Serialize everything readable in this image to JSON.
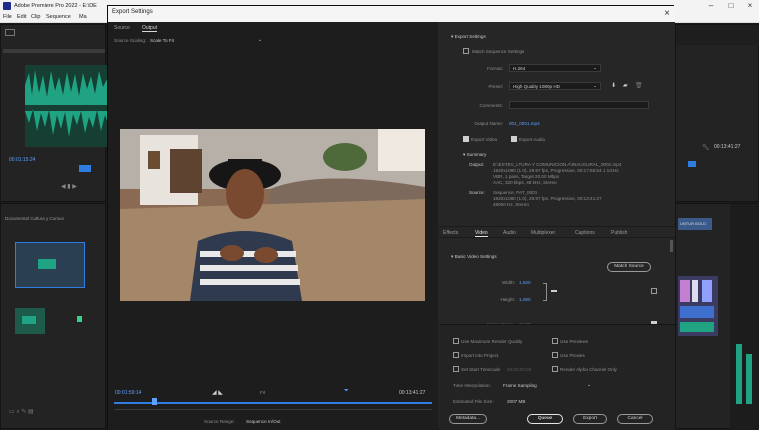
{
  "app": {
    "title": "Adobe Premiere Pro 2022 - E:\\DE",
    "menu": [
      "File",
      "Edit",
      "Clip",
      "Sequence",
      "Ma"
    ]
  },
  "background": {
    "source_time": "00:01:15:24",
    "timeline_time": "00:13:41:27",
    "project_label": "Documental Cultura y Comun",
    "timeline_clip_label": "UNTUR BOLD"
  },
  "dialog": {
    "title": "Export Settings",
    "close": "×",
    "tabs": {
      "source": "Source",
      "output": "Output"
    },
    "source_scaling": {
      "label": "Source Scaling:",
      "value": "Scale To Fit"
    },
    "timecode_in": "00:01:59:14",
    "timecode_out": "00:13:41:27",
    "fit_label": "Fit",
    "source_range": {
      "label": "Source Range:",
      "value": "Sequence In/Out"
    }
  },
  "export_settings": {
    "header": "Export Settings",
    "match_sequence": "Match Sequence Settings",
    "format": {
      "label": "Format:",
      "value": "H.264"
    },
    "preset": {
      "label": "Preset:",
      "value": "High Quality 1080p HD"
    },
    "comments": {
      "label": "Comments:"
    },
    "output_name": {
      "label": "Output Name:",
      "value": "001_0001.mp4"
    },
    "export_video": "Export Video",
    "export_audio": "Export Audio",
    "summary": {
      "header": "Summary",
      "output_label": "Output:",
      "output_lines": [
        "E:\\ESTEV_LTURA Y COMUNICION A\\INAUGURAL_0001.mp4",
        "1920x1080 (1.0), 29.97 fps, Progressive, 00:17:56:54.1 1GHz,",
        "VBR, 1 pass, Target 20.00 Mbps",
        "AAC, 320 kbps, 48 kHz, Stereo"
      ],
      "source_label": "Source:",
      "source_lines": [
        "Sequence, PAT_0001",
        "1920x1080 (1.0), 29.97 fps, Progressive, 00:13:41:27",
        "48000 Hz, Stereo"
      ]
    }
  },
  "video_tabs": [
    "Effects",
    "Video",
    "Audio",
    "Multiplexer",
    "Captions",
    "Publish"
  ],
  "basic_video": {
    "header": "Basic Video Settings",
    "match_source": "Match Source",
    "width": {
      "label": "Width:",
      "value": "1,920"
    },
    "height": {
      "label": "Height:",
      "value": "1,080"
    },
    "frame_rate": {
      "label": "Frame Rate:",
      "value": "29.97"
    }
  },
  "bottom_options": {
    "max_render": "Use Maximum Render Quality",
    "use_previews": "Use Previews",
    "import_project": "Import into Project",
    "set_start_tc": "Set Start Timecode",
    "start_tc_value": "00:00:00:00",
    "use_proxies": "Use Proxies",
    "render_alpha": "Render Alpha Channel Only",
    "time_interp": {
      "label": "Time Interpolation:",
      "value": "Frame Sampling"
    },
    "est_size": {
      "label": "Estimated File Size:",
      "value": "2007 MB"
    }
  },
  "actions": {
    "metadata": "Metadata...",
    "queue": "Queue",
    "export": "Export",
    "cancel": "Cancel"
  },
  "colors": {
    "accent_blue": "#2f7de1",
    "timecode_blue": "#5aa0ff",
    "waveform_green": "#1fa383"
  }
}
